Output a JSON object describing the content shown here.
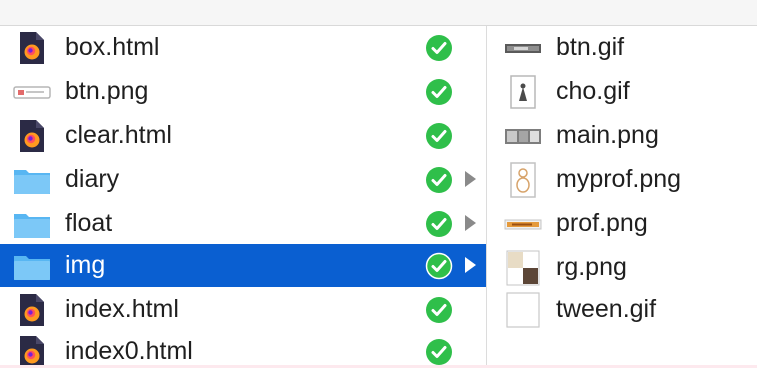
{
  "colors": {
    "selection": "#0a5fd1",
    "status_green": "#2fbf4a",
    "folder_blue": "#58b6f2"
  },
  "left_column": {
    "items": [
      {
        "name": "box.html",
        "icon": "firefox-html-file-icon",
        "status": "synced-check-icon"
      },
      {
        "name": "btn.png",
        "icon": "png-thumbnail-icon",
        "status": "synced-check-icon"
      },
      {
        "name": "clear.html",
        "icon": "firefox-html-file-icon",
        "status": "synced-check-icon"
      },
      {
        "name": "diary",
        "icon": "folder-icon",
        "status": "synced-check-icon",
        "has_children": true
      },
      {
        "name": "float",
        "icon": "folder-icon",
        "status": "synced-check-icon",
        "has_children": true
      },
      {
        "name": "img",
        "icon": "folder-icon",
        "status": "synced-check-icon",
        "has_children": true,
        "selected": true
      },
      {
        "name": "index.html",
        "icon": "firefox-html-file-icon",
        "status": "synced-check-icon"
      },
      {
        "name": "index0.html",
        "icon": "firefox-html-file-icon",
        "status": "synced-check-icon"
      }
    ]
  },
  "right_column": {
    "items": [
      {
        "name": "btn.gif",
        "icon": "gif-thumbnail-icon"
      },
      {
        "name": "cho.gif",
        "icon": "gif-thumbnail-icon"
      },
      {
        "name": "main.png",
        "icon": "png-thumbnail-icon"
      },
      {
        "name": "myprof.png",
        "icon": "png-thumbnail-icon"
      },
      {
        "name": "prof.png",
        "icon": "png-thumbnail-icon"
      },
      {
        "name": "rg.png",
        "icon": "png-thumbnail-icon"
      },
      {
        "name": "tween.gif",
        "icon": "gif-thumbnail-icon"
      }
    ]
  }
}
